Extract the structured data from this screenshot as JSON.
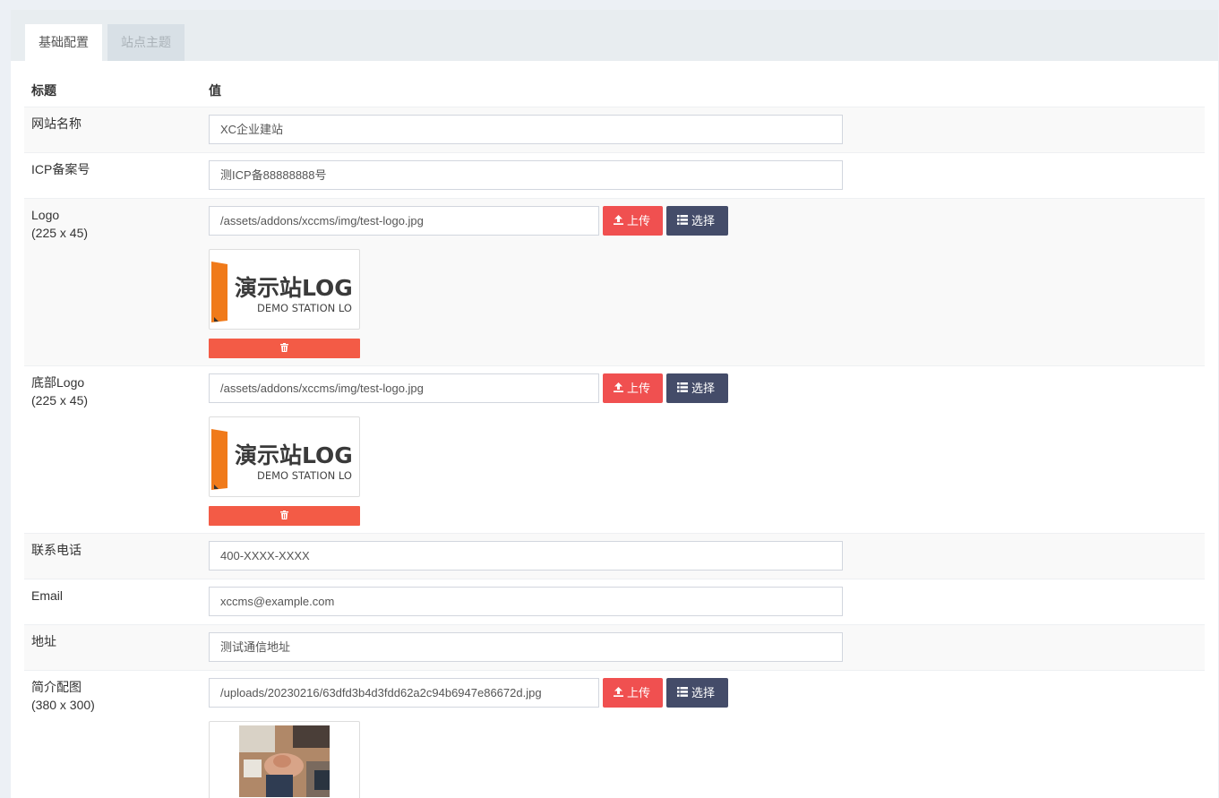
{
  "tabs": [
    {
      "label": "基础配置",
      "active": true
    },
    {
      "label": "站点主题",
      "active": false
    }
  ],
  "table": {
    "headers": {
      "title": "标题",
      "value": "值"
    }
  },
  "fields": {
    "site_name": {
      "label": "网站名称",
      "value": "XC企业建站"
    },
    "icp": {
      "label": "ICP备案号",
      "value": "测ICP备88888888号"
    },
    "logo": {
      "label": "Logo",
      "size": "(225 x 45)",
      "value": "/assets/addons/xccms/img/test-logo.jpg"
    },
    "footer_logo": {
      "label": "底部Logo",
      "size": "(225 x 45)",
      "value": "/assets/addons/xccms/img/test-logo.jpg"
    },
    "phone": {
      "label": "联系电话",
      "value": "400-XXXX-XXXX"
    },
    "email": {
      "label": "Email",
      "value": "xccms@example.com"
    },
    "address": {
      "label": "地址",
      "value": "测试通信地址"
    },
    "intro_image": {
      "label": "简介配图",
      "size": "(380 x 300)",
      "value": "/uploads/20230216/63dfd3b4d3fdd62a2c94b6947e86672d.jpg"
    }
  },
  "buttons": {
    "upload": "上传",
    "choose": "选择"
  },
  "logo_preview": {
    "main_text": "演示站LOG",
    "sub_text": "DEMO STATION LO"
  },
  "icons": {
    "upload": "upload-icon",
    "choose": "list-icon",
    "delete": "trash-icon"
  },
  "colors": {
    "upload_button": "#f05050",
    "choose_button": "#444c69",
    "delete_bar": "#f35b46",
    "logo_orange": "#f07a1a"
  }
}
